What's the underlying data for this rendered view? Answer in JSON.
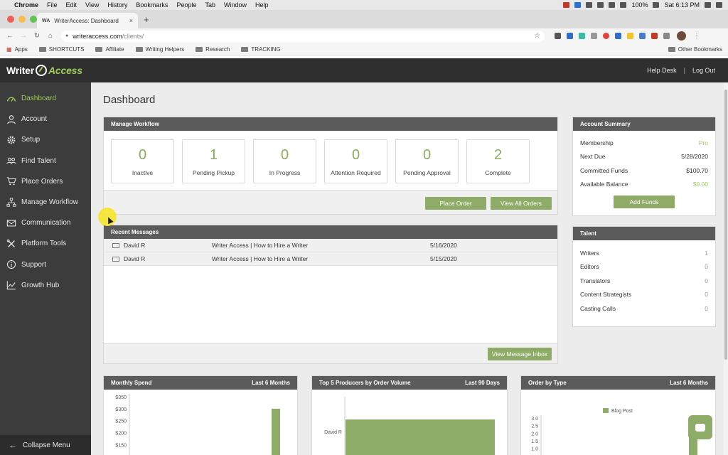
{
  "mac_menu": {
    "app": "Chrome",
    "items": [
      "File",
      "Edit",
      "View",
      "History",
      "Bookmarks",
      "People",
      "Tab",
      "Window",
      "Help"
    ],
    "battery": "100%",
    "clock": "Sat 6:13 PM"
  },
  "browser": {
    "tab_title": "WriterAccess: Dashboard",
    "tab_favicon": "WA",
    "url_host": "writeraccess.com",
    "url_path": "/clients/",
    "bookmarks": [
      "Apps",
      "SHORTCUTS",
      "Affiliate",
      "Writing Helpers",
      "Research",
      "TRACKING"
    ],
    "other_bookmarks": "Other Bookmarks"
  },
  "header": {
    "logo_left": "Writer",
    "logo_right": "Access",
    "help_desk": "Help Desk",
    "separator": "|",
    "logout": "Log Out"
  },
  "sidebar": {
    "items": [
      {
        "label": "Dashboard",
        "icon": "dashboard-icon"
      },
      {
        "label": "Account",
        "icon": "user-icon"
      },
      {
        "label": "Setup",
        "icon": "gear-icon"
      },
      {
        "label": "Find Talent",
        "icon": "users-icon"
      },
      {
        "label": "Place Orders",
        "icon": "cart-icon"
      },
      {
        "label": "Manage Workflow",
        "icon": "sitemap-icon"
      },
      {
        "label": "Communication",
        "icon": "envelope-icon"
      },
      {
        "label": "Platform Tools",
        "icon": "tools-icon"
      },
      {
        "label": "Support",
        "icon": "info-icon"
      },
      {
        "label": "Growth Hub",
        "icon": "chart-line-icon"
      }
    ],
    "collapse": "Collapse Menu"
  },
  "page": {
    "title": "Dashboard"
  },
  "workflow": {
    "title": "Manage Workflow",
    "stats": [
      {
        "value": "0",
        "label": "Inactive"
      },
      {
        "value": "1",
        "label": "Pending Pickup"
      },
      {
        "value": "0",
        "label": "In Progress"
      },
      {
        "value": "0",
        "label": "Attention Required"
      },
      {
        "value": "0",
        "label": "Pending Approval"
      },
      {
        "value": "2",
        "label": "Complete"
      }
    ],
    "place_order": "Place Order",
    "view_all": "View All Orders"
  },
  "messages": {
    "title": "Recent Messages",
    "rows": [
      {
        "from": "David R",
        "subject": "Writer Access | How to Hire a Writer",
        "date": "5/16/2020"
      },
      {
        "from": "David R",
        "subject": "Writer Access | How to Hire a Writer",
        "date": "5/15/2020"
      }
    ],
    "inbox_button": "View Message Inbox"
  },
  "account_summary": {
    "title": "Account Summary",
    "rows": [
      {
        "key": "Membership",
        "value": "Pro"
      },
      {
        "key": "Next Due",
        "value": "5/28/2020"
      },
      {
        "key": "Committed Funds",
        "value": "$100.70"
      },
      {
        "key": "Available Balance",
        "value": "$0.00"
      }
    ],
    "add_funds": "Add Funds"
  },
  "talent": {
    "title": "Talent",
    "rows": [
      {
        "key": "Writers",
        "value": "1"
      },
      {
        "key": "Editors",
        "value": "0"
      },
      {
        "key": "Translators",
        "value": "0"
      },
      {
        "key": "Content Strategists",
        "value": "0"
      },
      {
        "key": "Casting Calls",
        "value": "0"
      }
    ]
  },
  "charts": {
    "monthly_spend": {
      "title": "Monthly Spend",
      "range": "Last 6 Months"
    },
    "top_producers": {
      "title": "Top 5 Producers by Order Volume",
      "range": "Last 90 Days"
    },
    "order_by_type": {
      "title": "Order by Type",
      "range": "Last 6 Months"
    }
  },
  "chart_data": [
    {
      "type": "bar",
      "title": "Monthly Spend",
      "subtitle": "Last 6 Months",
      "ylim": [
        0,
        350
      ],
      "y_ticks": [
        "$350",
        "$300",
        "$250",
        "$200",
        "$150",
        "$100"
      ],
      "values": [
        300
      ],
      "grid": false
    },
    {
      "type": "bar",
      "title": "Top 5 Producers by Order Volume",
      "subtitle": "Last 90 Days",
      "orientation": "horizontal",
      "categories": [
        "David R"
      ],
      "values": [
        2
      ]
    },
    {
      "type": "bar",
      "title": "Order by Type",
      "subtitle": "Last 6 Months",
      "ylim": [
        0,
        3.0
      ],
      "y_ticks": [
        "3.0",
        "2.5",
        "2.0",
        "1.5",
        "1.0"
      ],
      "series": [
        {
          "name": "Blog Post",
          "values": [
            2
          ]
        }
      ],
      "legend": "top-center"
    }
  ],
  "colors": {
    "accent_green": "#8eab68",
    "logo_green": "#9fcb5a",
    "header_dark": "#2e2f2e",
    "sidebar": "#3b3c3b"
  }
}
